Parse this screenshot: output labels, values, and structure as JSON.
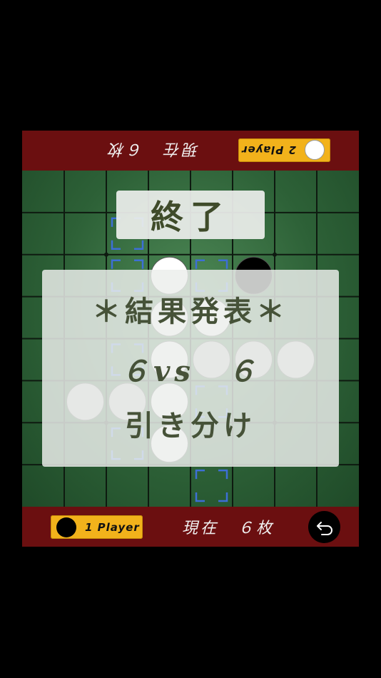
{
  "top_bar": {
    "player_label": "2 Player",
    "disc_color": "white",
    "count_text": "現在　６枚"
  },
  "bottom_bar": {
    "player_label": "1 Player",
    "disc_color": "black",
    "count_text": "現在　６枚",
    "back_icon": "undo-icon"
  },
  "overlay": {
    "title": "終了",
    "result_heading": "＊結果発表＊",
    "score": "６vs　６",
    "outcome": "引き分け"
  },
  "board": {
    "size": 8,
    "discs": [
      {
        "row": 2,
        "col": 3,
        "color": "white"
      },
      {
        "row": 2,
        "col": 5,
        "color": "black"
      },
      {
        "row": 3,
        "col": 3,
        "color": "white"
      },
      {
        "row": 3,
        "col": 4,
        "color": "white"
      },
      {
        "row": 4,
        "col": 3,
        "color": "white"
      },
      {
        "row": 4,
        "col": 4,
        "color": "gray"
      },
      {
        "row": 4,
        "col": 5,
        "color": "gray"
      },
      {
        "row": 4,
        "col": 6,
        "color": "gray"
      },
      {
        "row": 5,
        "col": 1,
        "color": "gray"
      },
      {
        "row": 5,
        "col": 2,
        "color": "gray"
      },
      {
        "row": 5,
        "col": 3,
        "color": "white"
      },
      {
        "row": 6,
        "col": 3,
        "color": "white"
      }
    ],
    "hints": [
      {
        "row": 1,
        "col": 2
      },
      {
        "row": 2,
        "col": 2
      },
      {
        "row": 2,
        "col": 4
      },
      {
        "row": 4,
        "col": 2
      },
      {
        "row": 5,
        "col": 4
      },
      {
        "row": 6,
        "col": 2
      },
      {
        "row": 7,
        "col": 4
      }
    ],
    "colors": {
      "white": "#ffffff",
      "black": "#000000",
      "gray": "#c9c9c9",
      "hint": "#3d6fd6"
    }
  }
}
